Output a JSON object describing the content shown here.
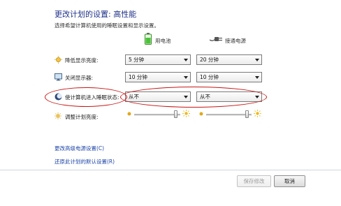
{
  "header": {
    "title": "更改计划的设置: 高性能",
    "subtitle": "选择希望计算机使用的睡眠设置和显示设置。"
  },
  "columns": {
    "battery": "用电池",
    "plugged": "接通电源"
  },
  "rows": {
    "dim": {
      "label": "降低显示亮度:",
      "battery": "5 分钟",
      "plugged": "20 分钟"
    },
    "off": {
      "label": "关闭显示器:",
      "battery": "10 分钟",
      "plugged": "10 分钟"
    },
    "sleep": {
      "label": "使计算机进入睡眠状态:",
      "battery": "从不",
      "plugged": "从不"
    },
    "brightness": {
      "label": "调整计划亮度:",
      "battery_level": 0.93,
      "plugged_level": 0.93
    }
  },
  "links": {
    "advanced": "更改高级电源设置(C)",
    "restore": "还原此计划的默认设置(R)"
  },
  "buttons": {
    "save": "保存修改",
    "cancel": "取消"
  },
  "colors": {
    "annotation": "#c81414",
    "title": "#1e3287",
    "link": "#1e46a8"
  }
}
